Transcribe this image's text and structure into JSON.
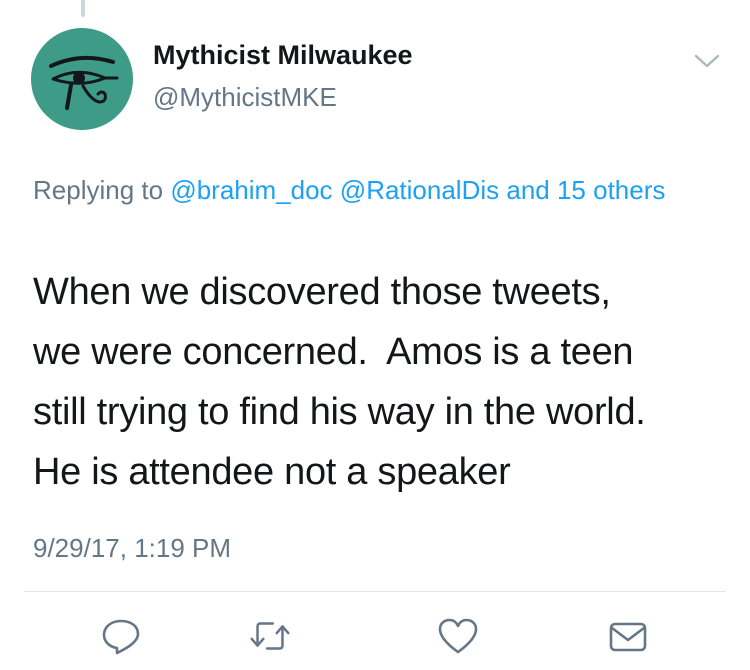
{
  "tweet": {
    "author": {
      "display_name": "Mythicist Milwaukee",
      "handle": "@MythicistMKE",
      "avatar_icon": "eye-of-horus-icon",
      "avatar_color": "#3d9b88"
    },
    "replying": {
      "prefix": "Replying to ",
      "mention_1": "@brahim_doc",
      "separator": " ",
      "mention_2": "@RationalDis",
      "others": " and 15 others"
    },
    "text_lines": [
      "When we discovered those tweets,",
      "we were concerned.  Amos is a teen",
      "still trying to find his way in the world.",
      "He is attendee not a speaker"
    ],
    "timestamp": "9/29/17, 1:19 PM"
  },
  "actions": [
    {
      "name": "reply",
      "icon": "reply-icon"
    },
    {
      "name": "retweet",
      "icon": "retweet-icon"
    },
    {
      "name": "like",
      "icon": "heart-icon"
    },
    {
      "name": "direct-message",
      "icon": "envelope-icon"
    }
  ],
  "colors": {
    "link": "#1da1f2",
    "secondary_text": "#657786",
    "primary_text": "#14171a",
    "icon": "#657786"
  }
}
